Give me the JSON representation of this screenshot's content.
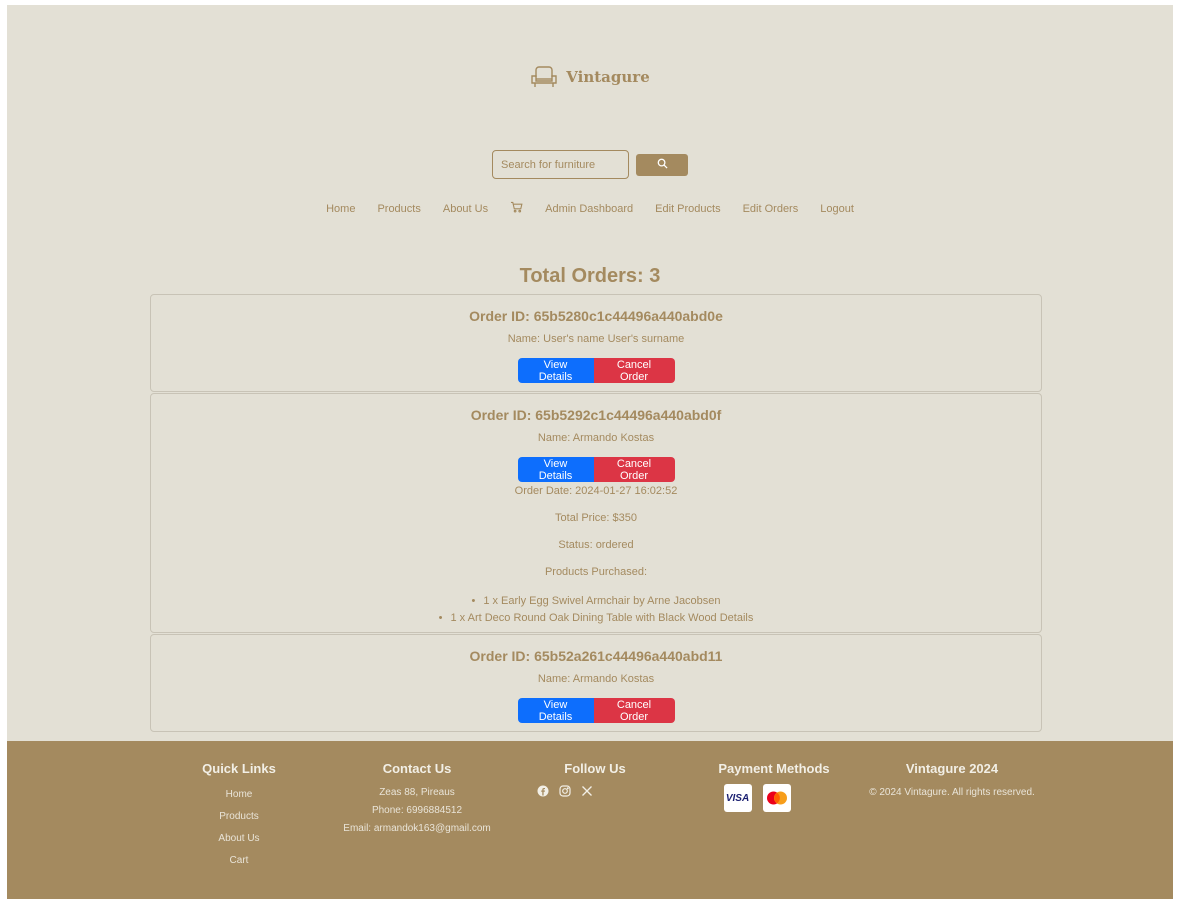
{
  "brand": {
    "name": "Vintagure",
    "logo_icon": "armchair-icon"
  },
  "search": {
    "placeholder": "Search for furniture",
    "icon": "search-icon"
  },
  "nav": {
    "items": [
      "Home",
      "Products",
      "About Us",
      "Admin Dashboard",
      "Edit Products",
      "Edit Orders",
      "Logout"
    ],
    "cart_icon": "cart-icon"
  },
  "main": {
    "title": "Total Orders: 3",
    "view_label": "View Details",
    "cancel_label": "Cancel Order",
    "orders": [
      {
        "id": "Order ID: 65b5280c1c44496a440abd0e",
        "name": "Name: User's name User's surname"
      },
      {
        "id": "Order ID: 65b5292c1c44496a440abd0f",
        "name": "Name: Armando Kostas",
        "date": "Order Date: 2024-01-27 16:02:52",
        "total": "Total Price: $350",
        "status": "Status: ordered",
        "products_label": "Products Purchased:",
        "products": [
          "1 x Early Egg Swivel Armchair by Arne Jacobsen",
          "1 x Art Deco Round Oak Dining Table with Black Wood Details"
        ]
      },
      {
        "id": "Order ID: 65b52a261c44496a440abd11",
        "name": "Name: Armando Kostas"
      }
    ]
  },
  "footer": {
    "quick_links": {
      "title": "Quick Links",
      "items": [
        "Home",
        "Products",
        "About Us",
        "Cart"
      ]
    },
    "contact": {
      "title": "Contact Us",
      "address": "Zeas 88, Pireaus",
      "phone": "Phone: 6996884512",
      "email": "Email: armandok163@gmail.com"
    },
    "follow": {
      "title": "Follow Us",
      "icons": [
        "facebook-icon",
        "instagram-icon",
        "x-icon"
      ]
    },
    "payment": {
      "title": "Payment Methods",
      "visa": "VISA",
      "icons": [
        "visa-icon",
        "mastercard-icon"
      ]
    },
    "copyright": {
      "title": "Vintagure 2024",
      "text": "© 2024 Vintagure. All rights reserved."
    }
  },
  "colors": {
    "background": "#e3e0d5",
    "accent": "#a48a5f",
    "view_button": "#0d6efd",
    "cancel_button": "#dc3545"
  }
}
